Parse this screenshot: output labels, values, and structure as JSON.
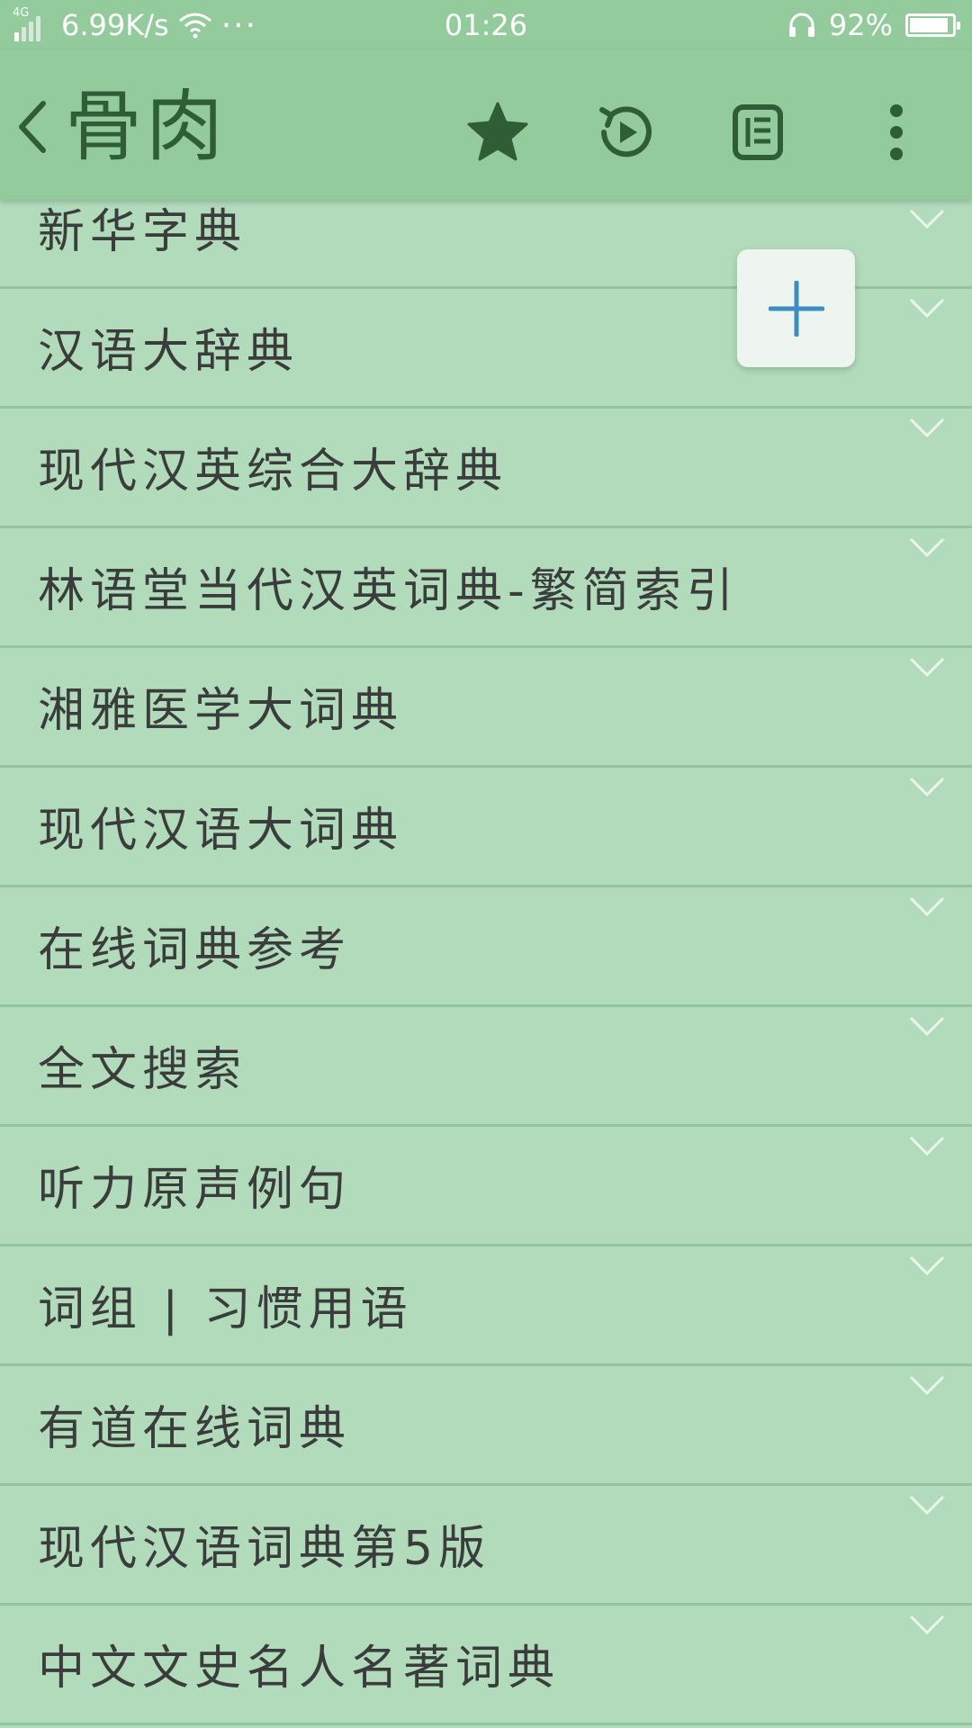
{
  "status_bar": {
    "network": "4G",
    "speed": "6.99K/s",
    "dots": "···",
    "time": "01:26",
    "battery_text": "92%",
    "battery_level": 0.92
  },
  "app_bar": {
    "title": "骨肉",
    "icons": [
      "back-chevron-icon",
      "star-icon",
      "replay-icon",
      "list-icon",
      "more-vert-icon"
    ]
  },
  "colors": {
    "bar_green": "#93cb9d",
    "list_bg": "#b2dbbb",
    "divider": "#93c49d",
    "icon_dark": "#2f5d36",
    "fab_plus": "#3a8ec0"
  },
  "list": {
    "items": [
      {
        "label": "新华字典"
      },
      {
        "label": "汉语大辞典"
      },
      {
        "label": "现代汉英综合大辞典"
      },
      {
        "label": "林语堂当代汉英词典-繁简索引"
      },
      {
        "label": "湘雅医学大词典"
      },
      {
        "label": "现代汉语大词典"
      },
      {
        "label": "在线词典参考"
      },
      {
        "label": "全文搜索"
      },
      {
        "label": "听力原声例句"
      },
      {
        "label": "词组 | 习惯用语"
      },
      {
        "label": "有道在线词典"
      },
      {
        "label": "现代汉语词典第5版"
      },
      {
        "label": "中文文史名人名著词典"
      }
    ]
  },
  "fab": {
    "icon": "plus-icon"
  }
}
